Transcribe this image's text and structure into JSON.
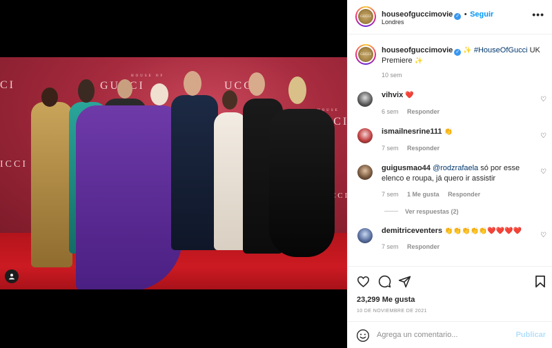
{
  "post": {
    "username": "houseofguccimovie",
    "location": "Londres",
    "follow_label": "Seguir",
    "more_label": "•••",
    "avatar_text": "GUCCI",
    "caption_sparkle_1": "✨",
    "caption_hashtag": "#HouseOfGucci",
    "caption_text": " UK Premiere ",
    "caption_sparkle_2": "✨",
    "caption_time": "10 sem",
    "likes": "23,299 Me gusta",
    "date": "10 DE NOVIEMBRE DE 2021"
  },
  "photo": {
    "poster_text_1": "HOUSE OF",
    "poster_text_2": "GUCCI",
    "poster_text_3": "UCCI",
    "poster_text_4": "HOUSE OF",
    "poster_text_5": "UCCI",
    "poster_text_6": "ICCI",
    "poster_text_7": "UCCI",
    "poster_text_8": "CI"
  },
  "comments": [
    {
      "user": "vihvix",
      "text": "❤️",
      "time": "6 sem",
      "reply": "Responder",
      "likes": ""
    },
    {
      "user": "ismailnesrine111",
      "text": "👏",
      "time": "7 sem",
      "reply": "Responder",
      "likes": ""
    },
    {
      "user": "guigusmao44",
      "mention": "@rodzrafaela",
      "text": " só por esse elenco e roupa, já quero ir assistir",
      "time": "7 sem",
      "likes": "1 Me gusta",
      "reply": "Responder"
    },
    {
      "user": "demitriceventers",
      "text": "👏👏👏👏👏❤️❤️❤️❤️",
      "time": "7 sem",
      "reply": "Responder",
      "likes": ""
    }
  ],
  "view_replies": "Ver respuestas (2)",
  "add_comment": {
    "placeholder": "Agrega un comentario...",
    "publish_label": "Publicar"
  },
  "icons": {
    "like": "heart-icon",
    "comment": "comment-icon",
    "share": "share-icon",
    "save": "bookmark-icon",
    "emoji": "emoji-icon",
    "tag": "user-tag-icon",
    "verified": "verified-badge-icon"
  },
  "colors": {
    "accent": "#0095f6",
    "hashtag": "#00376b",
    "secondary_text": "#8e8e8e",
    "publish_disabled": "#b2dffc"
  }
}
